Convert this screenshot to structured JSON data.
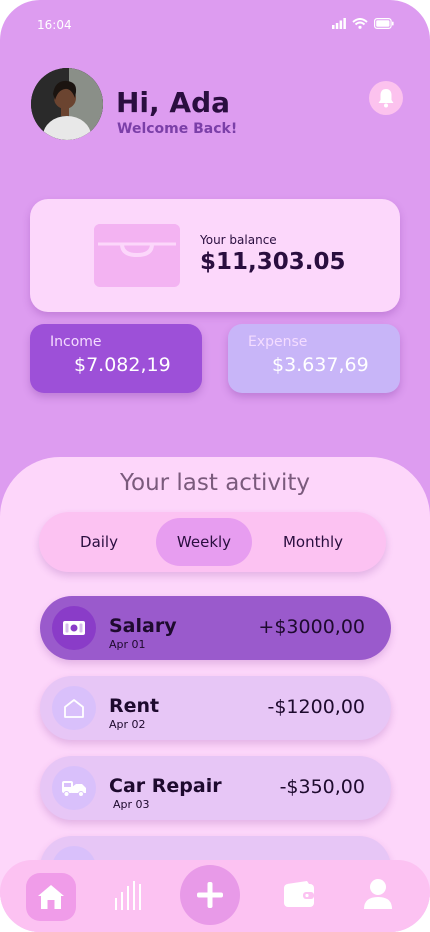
{
  "status": {
    "time": "16:04"
  },
  "header": {
    "greeting": "Hi, Ada",
    "subgreeting": "Welcome Back!"
  },
  "balance": {
    "label": "Your balance",
    "value": "$11,303.05"
  },
  "income": {
    "label": "Income",
    "value": "$7.082,19"
  },
  "expense": {
    "label": "Expense",
    "value": "$3.637,69"
  },
  "activity": {
    "title": "Your last activity",
    "tabs": [
      "Daily",
      "Weekly",
      "Monthly"
    ],
    "selected_tab": "Weekly",
    "transactions": [
      {
        "name": "Salary",
        "date": "Apr 01",
        "amount": "+$3000,00",
        "icon": "cash-icon",
        "active": true
      },
      {
        "name": "Rent",
        "date": "Apr 02",
        "amount": "-$1200,00",
        "icon": "home-icon",
        "active": false
      },
      {
        "name": "Car Repair",
        "date": "Apr 03",
        "amount": "-$350,00",
        "icon": "car-icon",
        "active": false
      }
    ]
  },
  "nav": {
    "items": [
      "home-icon",
      "chart-icon",
      "add-icon",
      "wallet-icon",
      "profile-icon"
    ],
    "selected": "home-icon"
  },
  "colors": {
    "background": "#dd9cf0",
    "income_card": "#9d50d8",
    "expense_card": "#c8b5f8",
    "sheet": "#fdd6fa",
    "text_dark": "#2a0e3f"
  }
}
